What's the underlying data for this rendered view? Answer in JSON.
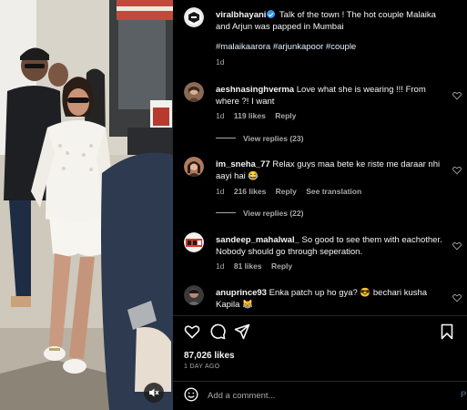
{
  "post": {
    "author": "viralbhayani",
    "verified": true,
    "caption": "Talk of the town ! The hot couple Malaika and Arjun was papped in Mumbai",
    "hashtags": "#malaikaarora #arjunkapoor #couple",
    "age": "1d"
  },
  "comments": [
    {
      "user": "aeshnasinghverma",
      "text": "Love what she is wearing !!! From where ?! I want",
      "age": "1d",
      "likes": "119 likes",
      "reply": "Reply",
      "view_replies": "View replies (23)"
    },
    {
      "user": "im_sneha_77",
      "text": "Relax guys maa bete ke riste me daraar nhi aayi hai 😂",
      "age": "1d",
      "likes": "216 likes",
      "reply": "Reply",
      "translate": "See translation",
      "view_replies": "View replies (22)"
    },
    {
      "user": "sandeep_mahalwal_",
      "text": "So good to see them with eachother. Nobody should go through seperation.",
      "age": "1d",
      "likes": "81 likes",
      "reply": "Reply"
    },
    {
      "user": "anuprince93",
      "text": "Enka patch up ho gya? 😎 bechari kusha Kapila 😹"
    }
  ],
  "stats": {
    "likes": "87,026 likes",
    "date": "1 DAY AGO"
  },
  "composer": {
    "placeholder": "Add a comment...",
    "post_label": "P"
  },
  "icons": {
    "like": "heart-icon",
    "comment": "comment-icon",
    "share": "send-icon",
    "save": "bookmark-icon",
    "emoji": "emoji-icon",
    "mute": "speaker-muted-icon"
  },
  "colors": {
    "background": "#000000",
    "verified": "#3797f0",
    "muted_text": "#a8a8a8"
  }
}
